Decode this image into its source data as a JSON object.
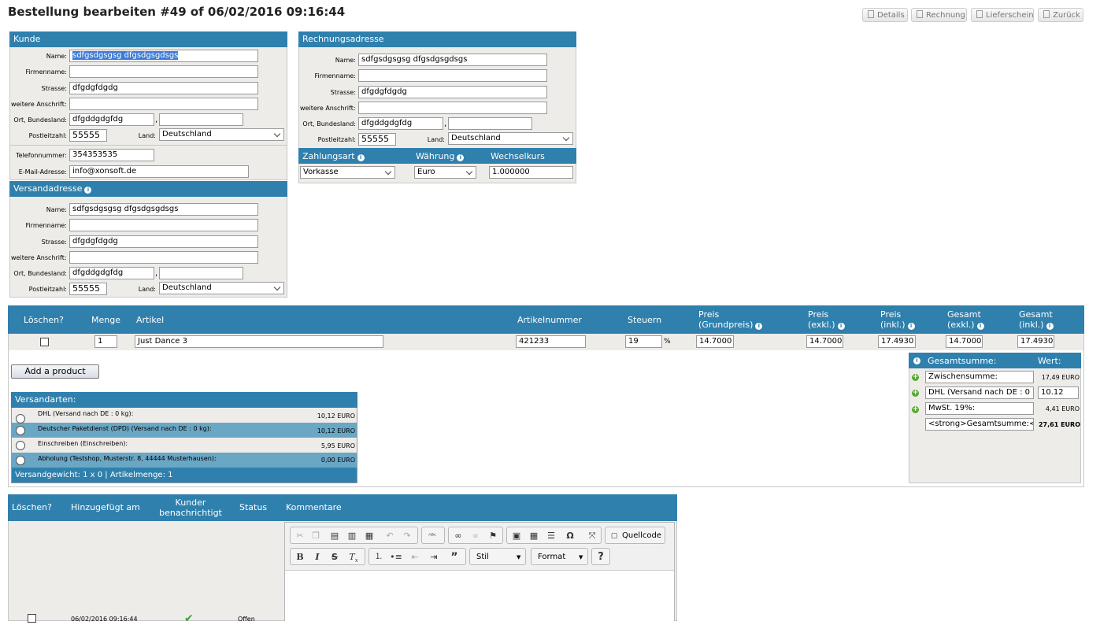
{
  "page": {
    "title": "Bestellung bearbeiten #49 of 06/02/2016 09:16:44"
  },
  "top_buttons": {
    "details": "Details",
    "rechnung": "Rechnung",
    "lieferschein": "Lieferschein",
    "zurueck": "Zurück"
  },
  "kunde": {
    "title": "Kunde",
    "labels": {
      "name": "Name:",
      "firma": "Firmenname:",
      "strasse": "Strasse:",
      "weitere": "weitere Anschrift:",
      "ort": "Ort, Bundesland:",
      "plz": "Postleitzahl:",
      "land": "Land:",
      "telefon": "Telefonnummer:",
      "email": "E-Mail-Adresse:"
    },
    "name": "sdfgsdgsgsg dfgsdgsgdsgs",
    "firma": "",
    "strasse": "dfgdgfdgdg",
    "weitere": "",
    "ort": "dfgddgdgfdg",
    "bundesland": "",
    "comma": ",",
    "plz": "55555",
    "land": "Deutschland",
    "telefon": "354353535",
    "email": "info@xonsoft.de"
  },
  "versand": {
    "title": "Versandadresse",
    "name": "sdfgsdgsgsg dfgsdgsgdsgs",
    "firma": "",
    "strasse": "dfgdgfdgdg",
    "weitere": "",
    "ort": "dfgddgdgfdg",
    "bundesland": "",
    "plz": "55555",
    "land": "Deutschland"
  },
  "rechnung": {
    "title": "Rechnungsadresse",
    "name": "sdfgsdgsgsg dfgsdgsgdsgs",
    "firma": "",
    "strasse": "dfgdgfdgdg",
    "weitere": "",
    "ort": "dfgddgdgfdg",
    "bundesland": "",
    "plz": "55555",
    "land": "Deutschland"
  },
  "zahlung": {
    "art_label": "Zahlungsart",
    "waehrung_label": "Währung",
    "kurs_label": "Wechselkurs",
    "art": "Vorkasse",
    "waehrung": "Euro",
    "kurs": "1.000000"
  },
  "products": {
    "headers": {
      "loeschen": "Löschen?",
      "menge": "Menge",
      "artikel": "Artikel",
      "artikelnummer": "Artikelnummer",
      "steuern": "Steuern",
      "preis_grund_1": "Preis",
      "preis_grund_2": "(Grundpreis)",
      "preis_exkl_1": "Preis",
      "preis_exkl_2": "(exkl.)",
      "preis_inkl_1": "Preis",
      "preis_inkl_2": "(inkl.)",
      "gesamt_exkl_1": "Gesamt",
      "gesamt_exkl_2": "(exkl.)",
      "gesamt_inkl_1": "Gesamt",
      "gesamt_inkl_2": "(inkl.)"
    },
    "row": {
      "menge": "1",
      "artikel": "Just Dance 3",
      "artikelnummer": "421233",
      "steuern": "19",
      "pct": "%",
      "preis_grund": "14.7000",
      "preis_exkl": "14.7000",
      "preis_inkl": "17.4930",
      "gesamt_exkl": "14.7000",
      "gesamt_inkl": "17.4930"
    },
    "add_button": "Add a product"
  },
  "versandarten": {
    "title": "Versandarten:",
    "items": [
      {
        "label": "DHL (Versand nach DE : 0 kg):",
        "price": "10,12 EURO"
      },
      {
        "label": "Deutscher Paketdienst (DPD) (Versand nach DE : 0 kg):",
        "price": "10,12 EURO"
      },
      {
        "label": "Einschreiben (Einschreiben):",
        "price": "5,95 EURO"
      },
      {
        "label": "Abholung (Testshop, Musterstr. 8, 44444 Musterhausen):",
        "price": "0,00 EURO"
      }
    ],
    "footer": "Versandgewicht: 1 x 0 | Artikelmenge: 1"
  },
  "totals": {
    "title": "Gesamtsumme:",
    "wert": "Wert:",
    "rows": [
      {
        "label": "Zwischensumme:",
        "value": "17,49 EURO"
      },
      {
        "label": "DHL (Versand nach DE : 0",
        "value": "10.12"
      },
      {
        "label": "MwSt. 19%:",
        "value": "4,41 EURO"
      },
      {
        "label": "<strong>Gesamtsumme:<",
        "value": "27,61 EURO"
      }
    ]
  },
  "history": {
    "headers": {
      "loeschen": "Löschen?",
      "hinzu": "Hinzugefügt am",
      "kunder_1": "Kunder",
      "kunder_2": "benachrichtigt",
      "status": "Status",
      "kommentare": "Kommentare"
    },
    "row": {
      "date": "06/02/2016 09:16:44",
      "status": "Offen"
    },
    "editor": {
      "quellcode": "Quellcode",
      "stil": "Stil",
      "format": "Format"
    }
  },
  "colors": {
    "header_blue": "#2f80ad",
    "panel_bg": "#eeece9",
    "row_highlight": "#6aa7c5"
  }
}
